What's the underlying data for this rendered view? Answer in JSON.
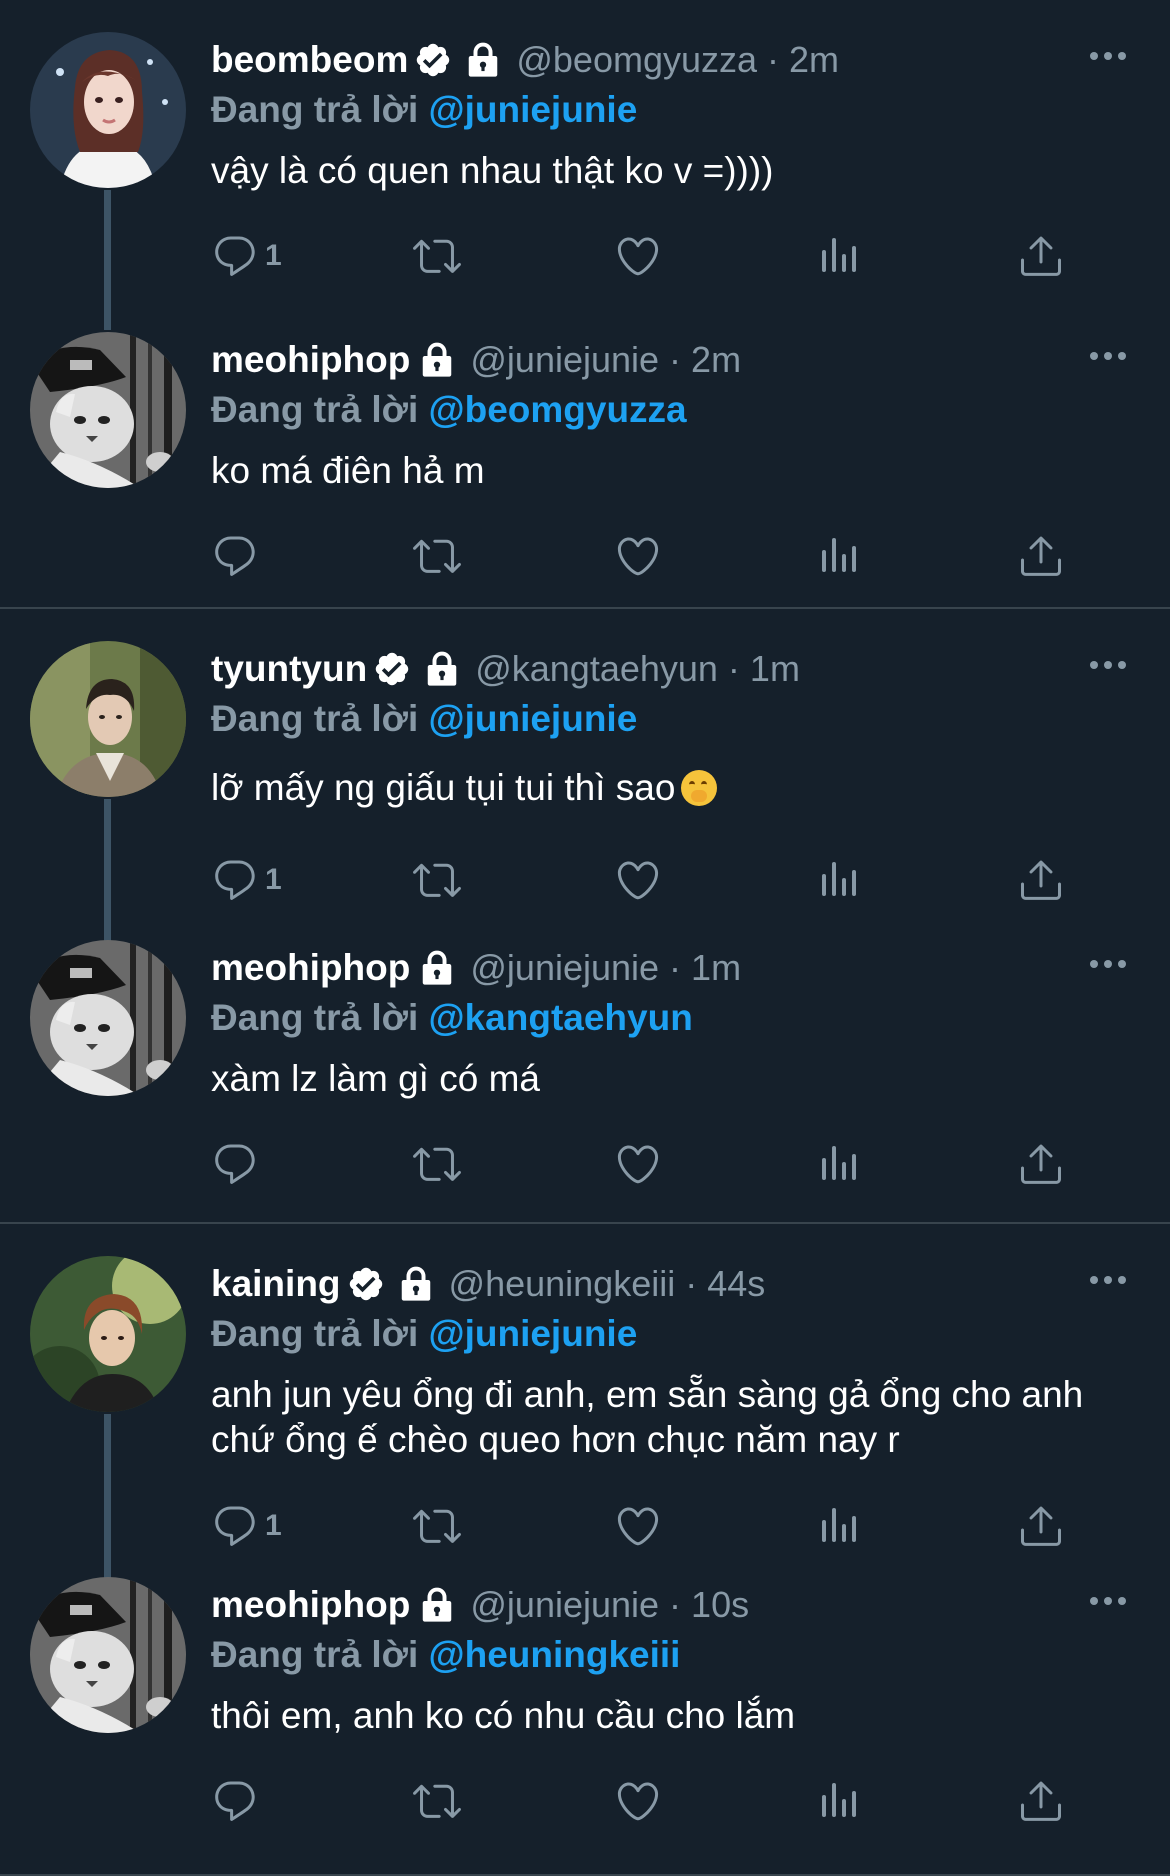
{
  "common": {
    "reply_prefix": "Đang trả lời ",
    "dot": "·"
  },
  "colors": {
    "background": "#15202b",
    "divider": "#38444d",
    "secondary_text": "#8899a6",
    "mention": "#1da1f2",
    "thread_line": "#3d5466"
  },
  "tweets": [
    {
      "display_name": "beombeom",
      "verified": true,
      "protected": true,
      "handle": "@beomgyuzza",
      "time": "2m",
      "reply_to": "@juniejunie",
      "text": "vậy là có quen nhau thật ko v =))))",
      "reply_count": "1",
      "avatar_icon": "avatar-girl-white-hair"
    },
    {
      "display_name": "meohiphop",
      "verified": false,
      "protected": true,
      "handle": "@juniejunie",
      "time": "2m",
      "reply_to": "@beomgyuzza",
      "text": "ko má điên hả m",
      "reply_count": "",
      "avatar_icon": "avatar-cat-bw"
    },
    {
      "display_name": "tyuntyun",
      "verified": true,
      "protected": true,
      "handle": "@kangtaehyun",
      "time": "1m",
      "reply_to": "@juniejunie",
      "text": "lỡ mấy ng giấu tụi tui thì sao",
      "emoji": "face-with-hand-over-mouth-emoji",
      "reply_count": "1",
      "avatar_icon": "avatar-boy-green"
    },
    {
      "display_name": "meohiphop",
      "verified": false,
      "protected": true,
      "handle": "@juniejunie",
      "time": "1m",
      "reply_to": "@kangtaehyun",
      "text": "xàm lz làm gì có má",
      "reply_count": "",
      "avatar_icon": "avatar-cat-bw"
    },
    {
      "display_name": "kaining",
      "verified": true,
      "protected": true,
      "handle": "@heuningkeiii",
      "time": "44s",
      "reply_to": "@juniejunie",
      "text": "anh jun yêu ổng đi anh, em sẵn sàng gả ổng cho anh chứ ổng ế chèo queo hơn chục năm nay r",
      "reply_count": "1",
      "avatar_icon": "avatar-boy-forest"
    },
    {
      "display_name": "meohiphop",
      "verified": false,
      "protected": true,
      "handle": "@juniejunie",
      "time": "10s",
      "reply_to": "@heuningkeiii",
      "text": "thôi em, anh ko có nhu cầu cho lắm",
      "reply_count": "",
      "avatar_icon": "avatar-cat-bw"
    }
  ]
}
